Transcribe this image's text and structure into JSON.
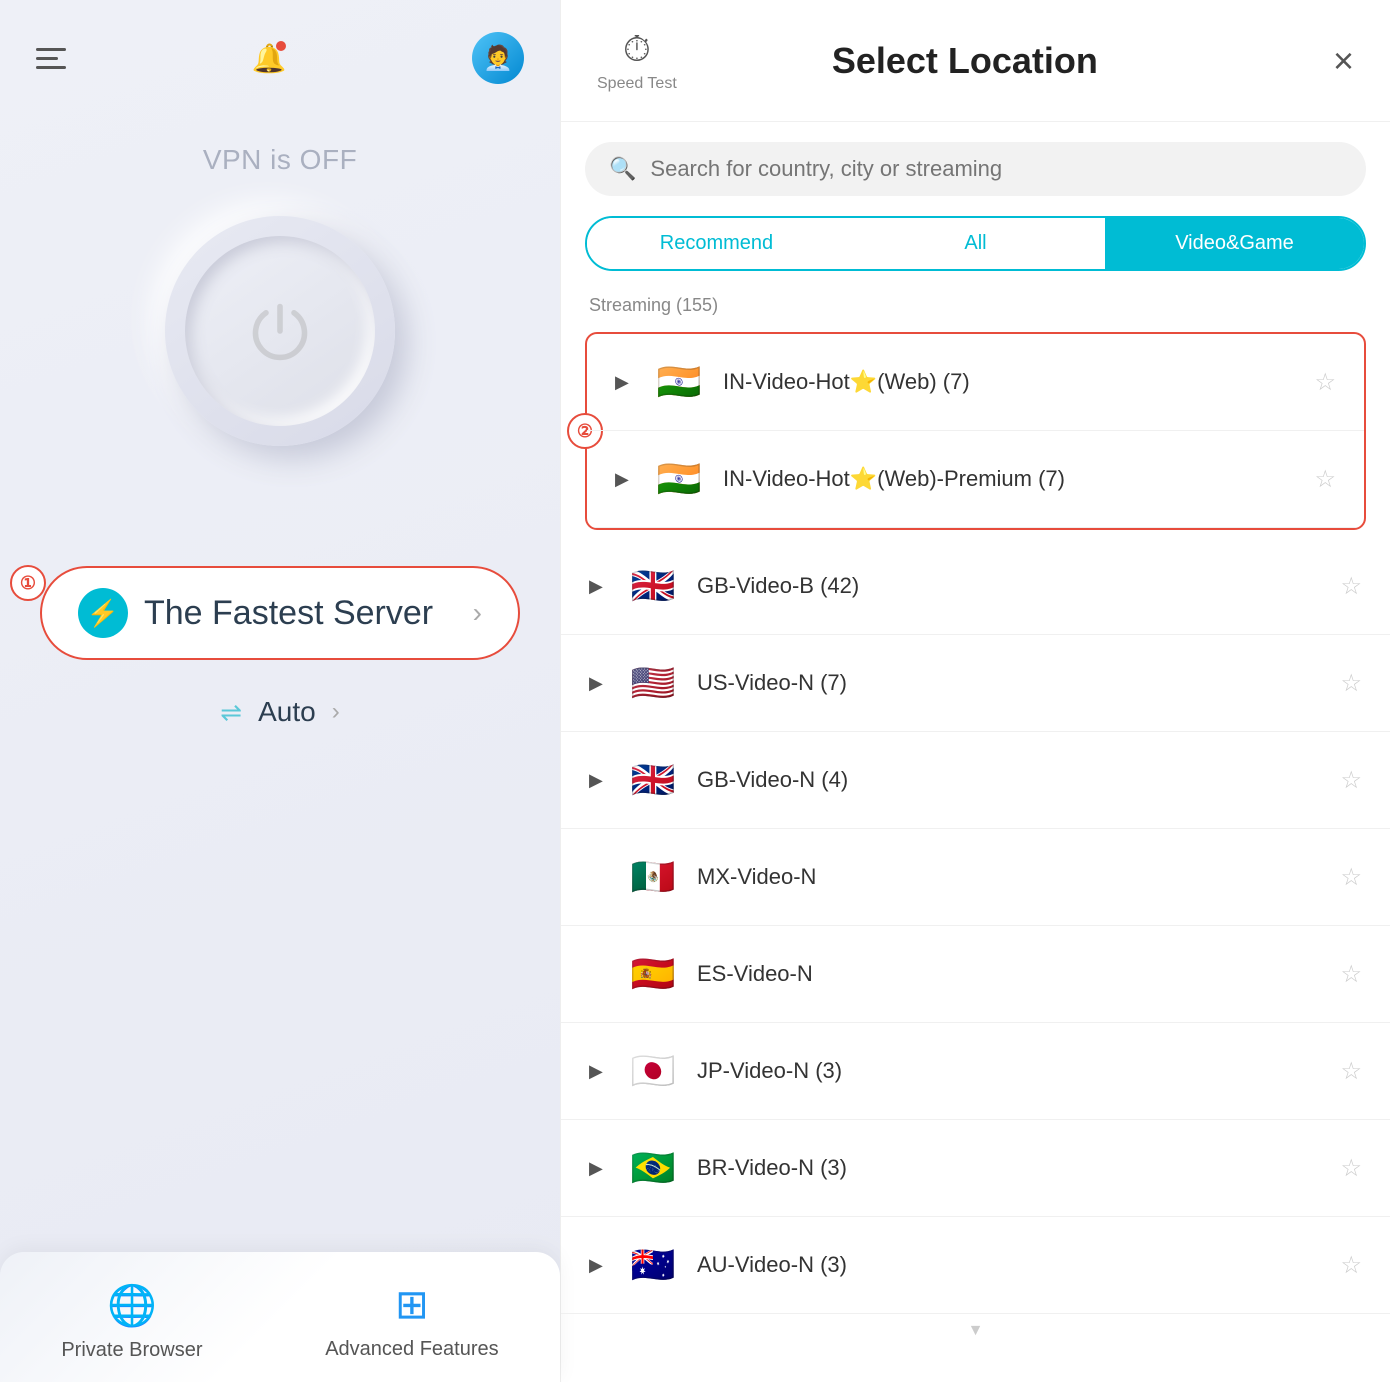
{
  "left": {
    "vpn_status": "VPN is OFF",
    "fastest_server_label": "The Fastest Server",
    "fastest_server_arrow": "›",
    "auto_label": "Auto",
    "auto_arrow": "›",
    "badge_1": "①",
    "nav": {
      "private_browser_label": "Private Browser",
      "advanced_features_label": "Advanced Features"
    }
  },
  "right": {
    "speed_test_label": "Speed Test",
    "title": "Select Location",
    "close_label": "×",
    "search_placeholder": "Search for country, city or streaming",
    "tabs": [
      {
        "label": "Recommend",
        "active": false
      },
      {
        "label": "All",
        "active": false
      },
      {
        "label": "Video&Game",
        "active": true
      }
    ],
    "streaming_header": "Streaming (155)",
    "badge_2": "②",
    "servers": [
      {
        "flag": "in",
        "name": "IN-Video-Hot⭐(Web) (7)",
        "expandable": true,
        "highlighted": true
      },
      {
        "flag": "in",
        "name": "IN-Video-Hot⭐(Web)-Premium (7)",
        "expandable": true,
        "highlighted": true
      },
      {
        "flag": "gb",
        "name": "GB-Video-B (42)",
        "expandable": true,
        "highlighted": false
      },
      {
        "flag": "us",
        "name": "US-Video-N (7)",
        "expandable": true,
        "highlighted": false
      },
      {
        "flag": "gb",
        "name": "GB-Video-N (4)",
        "expandable": true,
        "highlighted": false
      },
      {
        "flag": "mx",
        "name": "MX-Video-N",
        "expandable": false,
        "highlighted": false
      },
      {
        "flag": "es",
        "name": "ES-Video-N",
        "expandable": false,
        "highlighted": false
      },
      {
        "flag": "jp",
        "name": "JP-Video-N (3)",
        "expandable": true,
        "highlighted": false
      },
      {
        "flag": "br",
        "name": "BR-Video-N (3)",
        "expandable": true,
        "highlighted": false
      },
      {
        "flag": "au",
        "name": "AU-Video-N (3)",
        "expandable": true,
        "highlighted": false
      }
    ]
  }
}
